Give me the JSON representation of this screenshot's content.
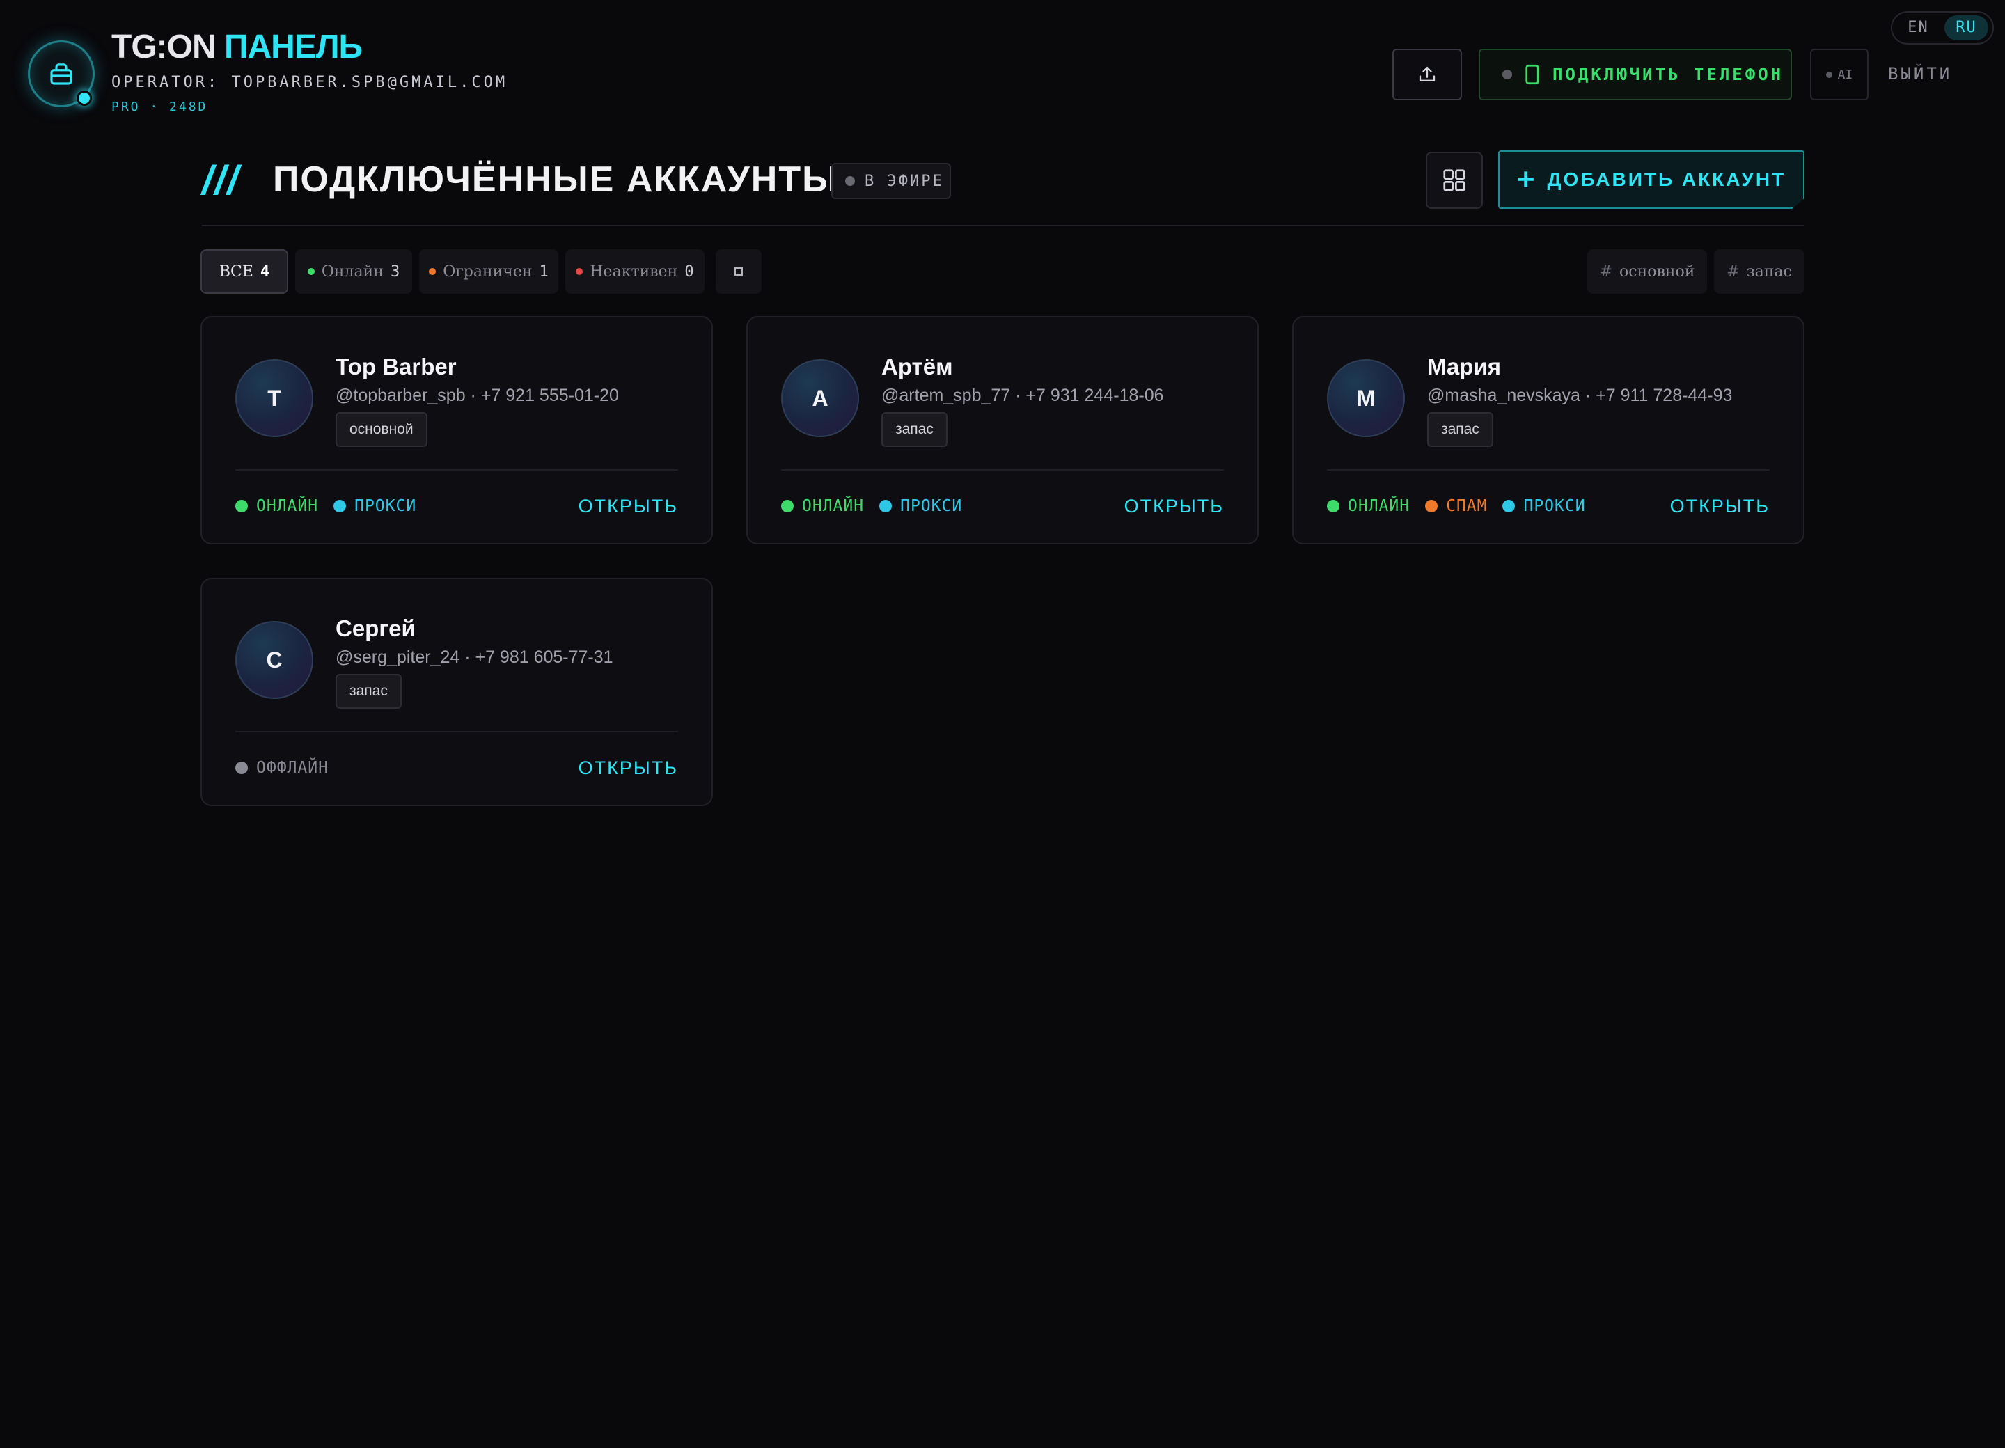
{
  "header": {
    "brand_main": "TG:ON",
    "brand_accent": "ПАНЕЛЬ",
    "operator": "OPERATOR: TOPBARBER.SPB@GMAIL.COM",
    "plan": "PRO · 248D",
    "lang": {
      "en": "EN",
      "ru": "RU",
      "active": "RU"
    },
    "connect_phone": "ПОДКЛЮЧИТЬ ТЕЛЕФОН",
    "ai": "AI",
    "logout": "ВЫЙТИ"
  },
  "section": {
    "slashes": "///",
    "title": "ПОДКЛЮЧЁННЫЕ АККАУНТЫ",
    "live": "В ЭФИРЕ",
    "add_account": "ДОБАВИТЬ АККАУНТ"
  },
  "filters": [
    {
      "label": "ВСЕ",
      "count": "4",
      "active": true
    },
    {
      "label": "Онлайн",
      "count": "3",
      "color": "#3ddc6a"
    },
    {
      "label": "Ограничен",
      "count": "1",
      "color": "#f07a2a"
    },
    {
      "label": "Неактивен",
      "count": "0",
      "color": "#e84848"
    }
  ],
  "tag_filters": [
    {
      "hash": "#",
      "label": "основной"
    },
    {
      "hash": "#",
      "label": "запас"
    }
  ],
  "accounts": [
    {
      "initial": "T",
      "name": "Top Barber",
      "meta": "@topbarber_spb · +7 921 555-01-20",
      "tag": "основной",
      "statuses": [
        {
          "label": "ОНЛАЙН",
          "color": "#3ddc6a"
        },
        {
          "label": "ПРОКСИ",
          "color": "#2ec8e8"
        }
      ],
      "open": "ОТКРЫТЬ"
    },
    {
      "initial": "А",
      "name": "Артём",
      "meta": "@artem_spb_77 · +7 931 244-18-06",
      "tag": "запас",
      "statuses": [
        {
          "label": "ОНЛАЙН",
          "color": "#3ddc6a"
        },
        {
          "label": "ПРОКСИ",
          "color": "#2ec8e8"
        }
      ],
      "open": "ОТКРЫТЬ"
    },
    {
      "initial": "М",
      "name": "Мария",
      "meta": "@masha_nevskaya · +7 911 728-44-93",
      "tag": "запас",
      "statuses": [
        {
          "label": "ОНЛАЙН",
          "color": "#3ddc6a"
        },
        {
          "label": "СПАМ",
          "color": "#f07a2a"
        },
        {
          "label": "ПРОКСИ",
          "color": "#2ec8e8"
        }
      ],
      "open": "ОТКРЫТЬ"
    },
    {
      "initial": "С",
      "name": "Сергей",
      "meta": "@serg_piter_24 · +7 981 605-77-31",
      "tag": "запас",
      "statuses": [
        {
          "label": "ОФФЛАЙН",
          "color": "#8a8a94"
        }
      ],
      "open": "ОТКРЫТЬ"
    }
  ],
  "colors": {
    "accent": "#2ee4f5",
    "online": "#3ddc6a",
    "spam": "#f07a2a",
    "inactive": "#e84848",
    "proxy": "#2ec8e8"
  }
}
